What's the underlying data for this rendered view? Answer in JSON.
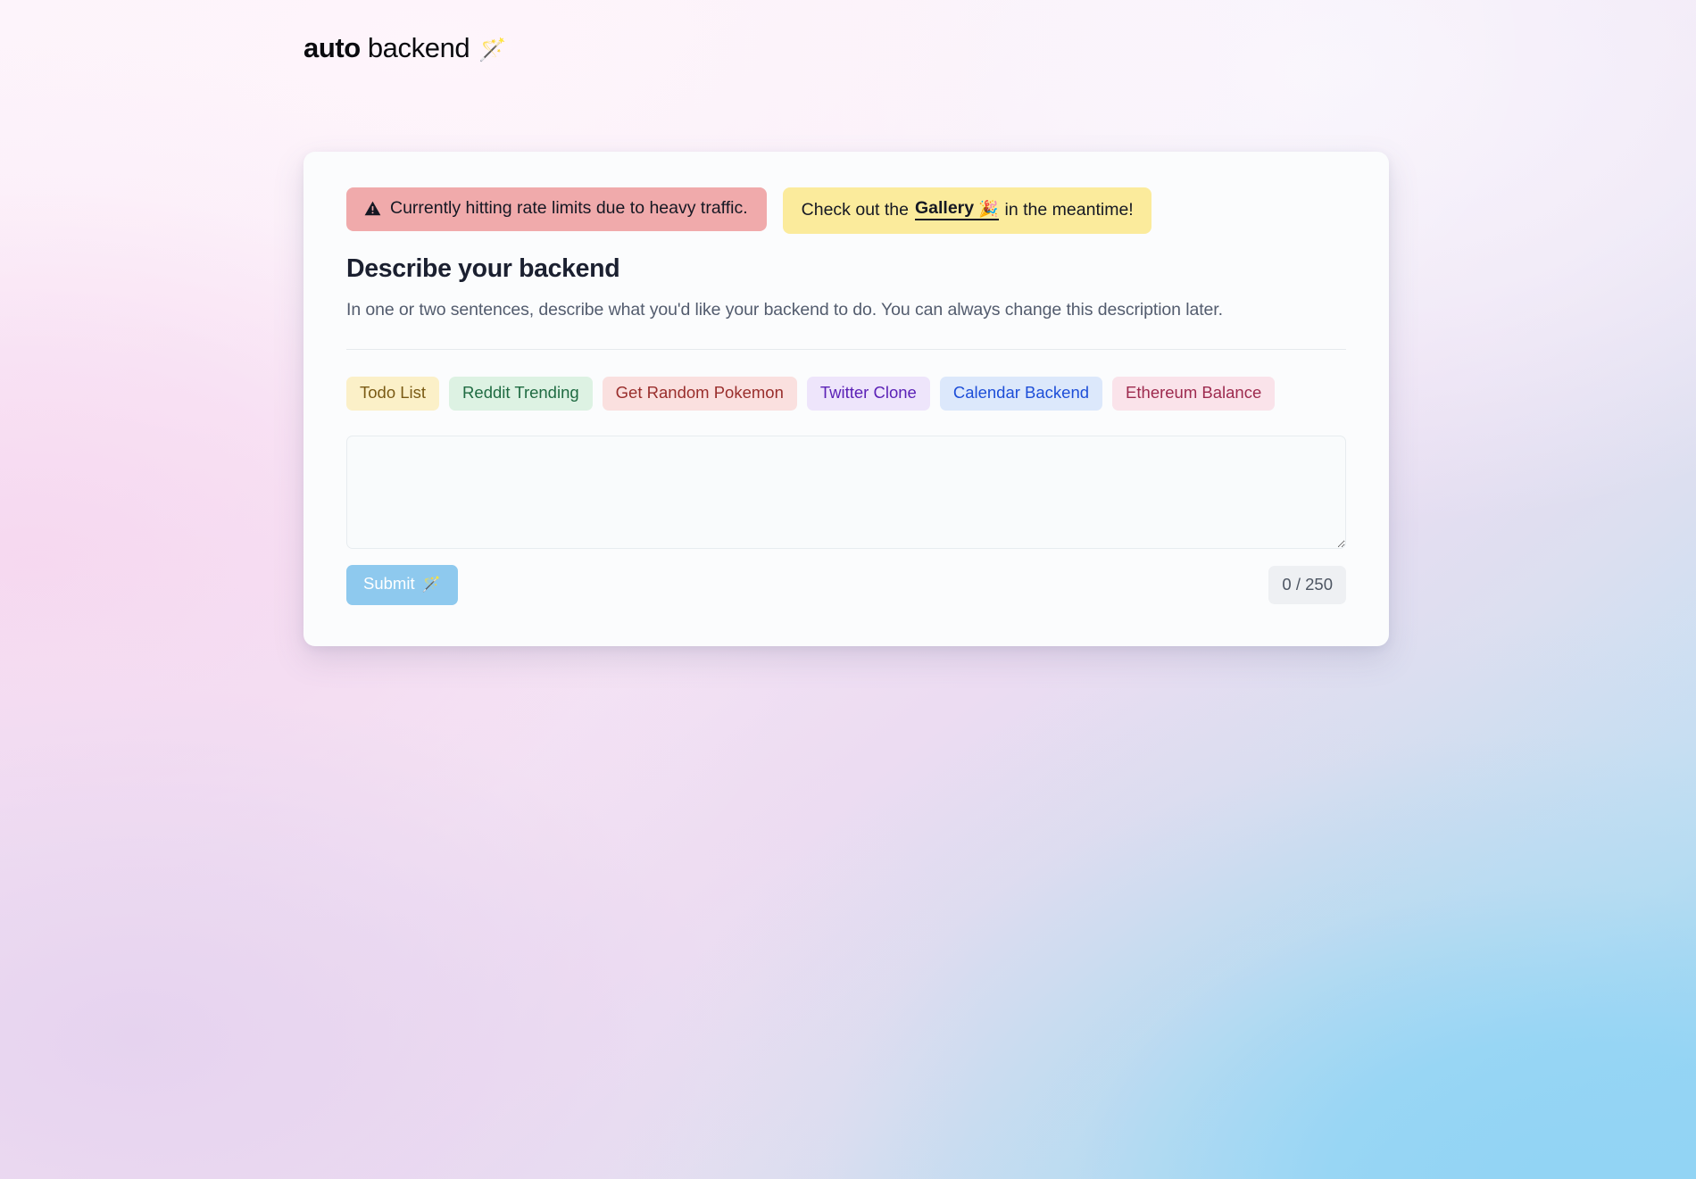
{
  "brand": {
    "name_bold": "auto",
    "name_regular": "backend",
    "wand_icon": "🪄"
  },
  "banners": {
    "rate_limit": {
      "icon": "warning-triangle-icon",
      "text": "Currently hitting rate limits due to heavy traffic.",
      "background": "#f0aaab"
    },
    "gallery": {
      "prefix": "Check out the",
      "link_label": "Gallery",
      "link_icon": "🎉",
      "suffix": "in the meantime!",
      "background": "#fbeb9c"
    }
  },
  "form": {
    "heading": "Describe your backend",
    "subheading": "In one or two sentences, describe what you'd like your backend to do. You can always change this description later.",
    "textarea_value": "",
    "textarea_placeholder": "",
    "submit_label": "Submit",
    "submit_icon": "🪄",
    "counter": "0 / 250",
    "char_used": 0,
    "char_limit": 250
  },
  "presets": [
    {
      "label": "Todo List",
      "bg": "#fbf0c8",
      "fg": "#7a5a14"
    },
    {
      "label": "Reddit Trending",
      "bg": "#ddf2e3",
      "fg": "#1f6b42"
    },
    {
      "label": "Get Random Pokemon",
      "bg": "#fae0df",
      "fg": "#992e2c"
    },
    {
      "label": "Twitter Clone",
      "bg": "#eee5fb",
      "fg": "#5b21b6"
    },
    {
      "label": "Calendar Backend",
      "bg": "#dce8fb",
      "fg": "#1d4ed8"
    },
    {
      "label": "Ethereum Balance",
      "bg": "#fae3ea",
      "fg": "#9d2a4e"
    }
  ]
}
